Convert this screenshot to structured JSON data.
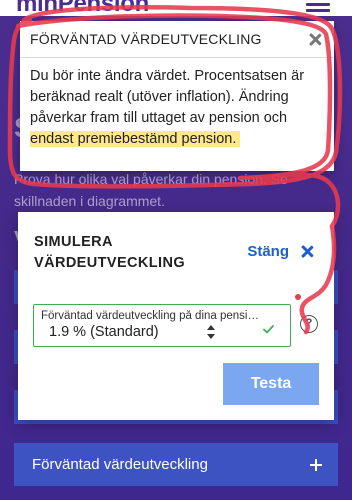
{
  "header": {
    "logo": "minPension"
  },
  "background": {
    "heading": "S",
    "body": "Prova hur olika val påverkar din pension. Se skillnaden i diagrammet.",
    "section_initial": "V",
    "accordion_label": "Förväntad värdeutveckling"
  },
  "tooltip": {
    "title": "FÖRVÄNTAD VÄRDEUTVECKLING",
    "text_1": "Du bör inte ändra värdet. Procentsatsen är beräknad realt (utöver inflation). Ändring påverkar fram till uttaget av pension och ",
    "text_highlight": "endast premiebestämd pension."
  },
  "simulation": {
    "title": "SIMULERA VÄRDEUTVECKLING",
    "close_label": "Stäng",
    "field_label": "Förväntad värdeutveckling på dina pensi…",
    "field_value": "1.9 % (Standard)",
    "help_label": "?",
    "test_button": "Testa"
  },
  "colors": {
    "brand_purple": "#4d2c8f",
    "link_blue": "#1f5fc7",
    "button_blue": "#7ba6f0",
    "valid_green": "#3cae56",
    "highlight_yellow": "#fde98a",
    "annotation_red": "#e83a4e"
  }
}
